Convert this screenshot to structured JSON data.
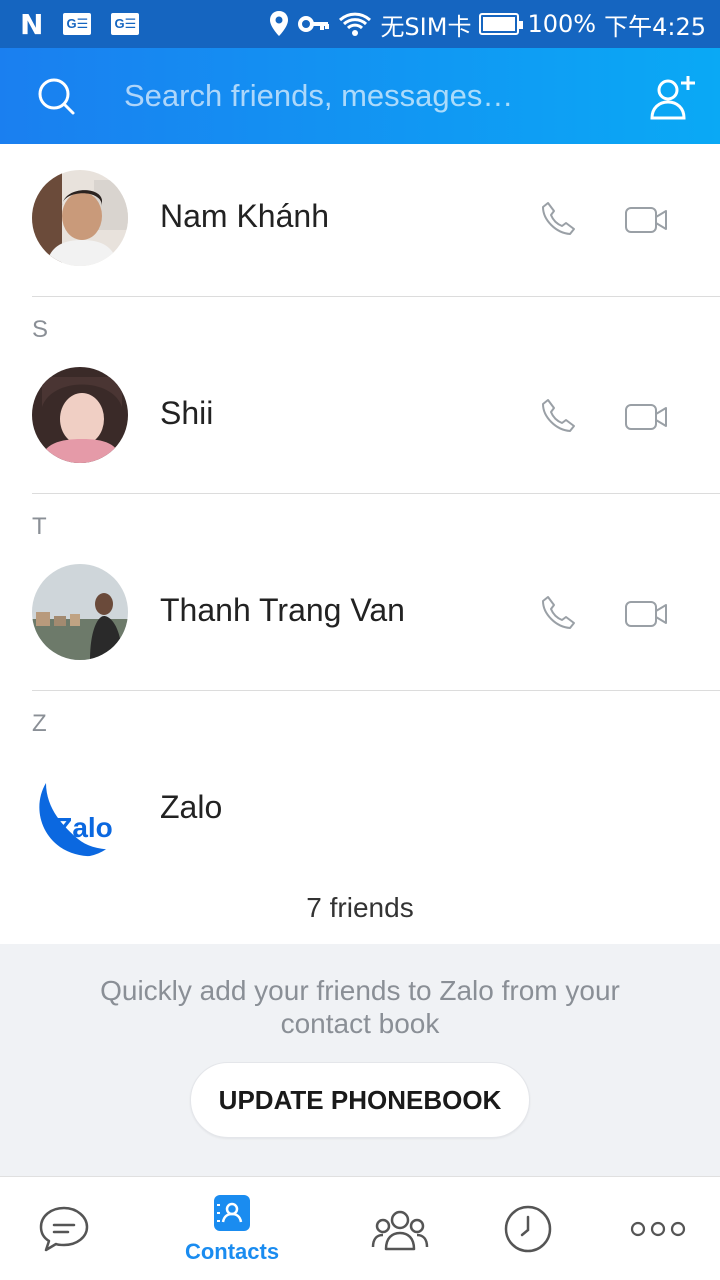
{
  "status_bar": {
    "left_icons": [
      "n-logo-icon",
      "ge-box",
      "ge-box"
    ],
    "ge_label": "G☰",
    "n_label": "N",
    "sim_text": "无SIM卡",
    "battery_percent_text": "100%",
    "battery_level": 1.0,
    "time": "下午4:25"
  },
  "header": {
    "search_placeholder": "Search friends, messages…",
    "colors": {
      "gradient_start": "#1a7ff0",
      "gradient_end": "#0aa9f5"
    }
  },
  "contacts": [
    {
      "name": "Nam Khánh",
      "section": ""
    },
    {
      "name": "Shii",
      "section": "S"
    },
    {
      "name": "Thanh Trang Van",
      "section": "T"
    },
    {
      "name": "Zalo",
      "section": "Z"
    }
  ],
  "zalo_logo_text": "Zalo",
  "friends_count": "7 friends",
  "promo": {
    "text": "Quickly add your friends to Zalo from your contact book",
    "button_label": "UPDATE PHONEBOOK"
  },
  "bottom_nav": {
    "active_label": "Contacts",
    "items": [
      "messages-icon",
      "contacts-icon",
      "groups-icon",
      "timeline-icon",
      "more-icon"
    ],
    "accent": "#1a8cf0"
  }
}
